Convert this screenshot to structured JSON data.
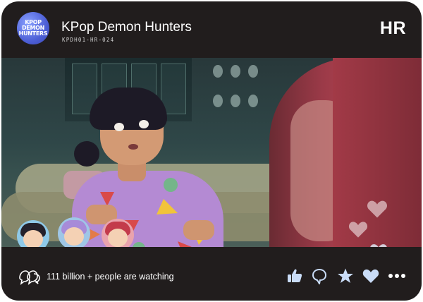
{
  "header": {
    "logo_lines": [
      "KPOP",
      "DEMON",
      "HUNTERS"
    ],
    "title": "KPop Demon Hunters",
    "code": "KPDH01-HR-024",
    "rarity": "HR"
  },
  "scene": {
    "character_avatars": [
      "avatar-angry-girl",
      "avatar-purple-braid",
      "avatar-red-hair"
    ]
  },
  "footer": {
    "watchers_text": "111 billion + people are watching",
    "actions": [
      "thumbs-up-icon",
      "chat-bubble-icon",
      "star-icon",
      "heart-icon",
      "more-icon"
    ]
  },
  "colors": {
    "card_bg": "#211d1d",
    "text": "#ffffff",
    "action_icon": "#c9dcf7"
  }
}
